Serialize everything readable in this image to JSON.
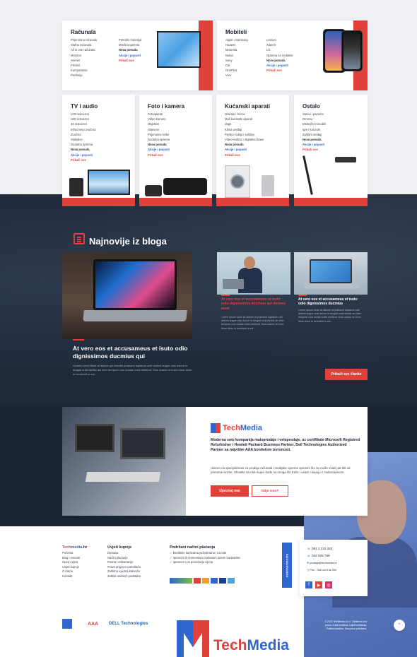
{
  "categories": {
    "racunala": {
      "title": "Računala",
      "col1": [
        "Prijenosna računala",
        "Stolna računala",
        "All in one računala",
        "Monitori",
        "Serveri",
        "Printeri",
        "Komponente",
        "Periferija"
      ],
      "col2": [
        "Potrošni materijal",
        "Mrežna oprema",
        "Nova ponuda",
        "Akcije i popusti",
        "Prikaži sve"
      ]
    },
    "mobiteli": {
      "title": "Mobiteli",
      "col1": [
        "Apple i Samsung",
        "Huawei",
        "Motorola",
        "Nokia",
        "Sony",
        "Cat",
        "OnePlus",
        "Vivo"
      ],
      "col2": [
        "Lenovo",
        "Xiaomi",
        "LG",
        "Oprema za mobitele",
        "Nova ponuda",
        "Akcije i popusti",
        "Prikaži sve"
      ]
    },
    "tv": {
      "title": "TV i audio",
      "items": [
        "LCD televizori",
        "LED televizori",
        "4K televizori",
        "Infracrveni zvučnici",
        "Zvučnici",
        "Slušalice",
        "Dodatna oprema",
        "Nova ponuda",
        "Akcije i popusti",
        "Prikaži sve"
      ]
    },
    "foto": {
      "title": "Foto i kamera",
      "items": [
        "Fotoaparati",
        "Video kamere",
        "Objektivi",
        "Stativovi",
        "Prijenosne torbe",
        "Dodatna oprema",
        "Nova ponuda",
        "Akcije i popusti",
        "Prikaži sve"
      ]
    },
    "kucanski": {
      "title": "Kućanski aparati",
      "items": [
        "Glačala i fenovi",
        "Mali kućanski aparati",
        "Vage",
        "Klima uređaji",
        "Perilice rublja i sušilice",
        "Video-nadzor i digitalne brave",
        "Nova ponuda",
        "Akcije i popusti",
        "Prikaži sve"
      ]
    },
    "ostalo": {
      "title": "Ostalo",
      "items": [
        "Satovi i pametni",
        "Dronovi",
        "Električni romobili",
        "Igre i konzole",
        "Zaštitni uređaji",
        "Nova ponuda",
        "Akcije i popusti",
        "Prikaži sve"
      ]
    }
  },
  "blog": {
    "heading": "Najnovije iz bloga",
    "main_title": "At vero eos et accusameus et isuto odio dignissimos ducmius qui",
    "main_excerpt": "Uvobim kredi Blkdt at diavee qui blanditi praesent luptatum zzril delenit augue duis dolore te feugait nulla facilisi am liber tempore cum soluta nobis eleifend. Duis autem vel eum iriure dolor in hendrerit in vul...",
    "post2_title": "At vero eos et accusameus et isuto odio dignissimos ducmius qui dolores amet",
    "post2_excerpt": "Lorem ipsum dolor sit diavee at praesent luptatum zzril delenit augue duis dolore te feugait nulla facilisi am liber tempore cum soluta nobis eleifend. Duis autem vel eum iriure dolor in hendrerit in vul...",
    "post3_title": "At vero eos et accusameus et isuto odio dignissimos ducmius",
    "post3_excerpt": "Lorem ipsum dolor sit diavee at praesent luptatum zzril delenit augue duis dolore te feugait nulla facilisi am liber tempore cum soluta nobis eleifend. Duis autem vel eum iriure dolor in hendrerit in vul...",
    "all_button": "Prikaži sve članke"
  },
  "about": {
    "brand_part1": "Tech",
    "brand_part2": "Media",
    "bold_text": "Moderna smo kompanija maloprodaje i veleprodaje, uz certifikate Microsoft Registred Refurbisher i Hewlett Packard Business Partner, Dell Technologies Authorized Partner sa najvišim AAA bonitetom izvrsnosti.",
    "text": "Uskoro na specijalizirani za prodaju računala i medijske opreme spremni što ne može svaki put biti od primarne brzine. Shvatite da nam kupci dođu na onoga što traže i usluzi i kupuju s zadovoljstvom.",
    "btn_primary": "Upoznaj nas",
    "btn_secondary": "Gdje smo?"
  },
  "footer": {
    "col1_title_a": "Tech",
    "col1_title_b": "media",
    "col1_title_c": ".hr",
    "col1_items": [
      "Početna",
      "Blog i novosti",
      "Opća uvjeta",
      "Uvjeti kupnje",
      "O nama",
      "Kontakt"
    ],
    "col2_title": "Uvjeti kupnje",
    "col2_items": [
      "Dostava",
      "Načini plaćanja",
      "Povrat i reklamacije",
      "Pravo prigovor potrošača",
      "Zaštitna uvjetna kakvoće",
      "Zaštita osobnih podataka"
    ],
    "col3_title": "Podržani načini plaćanja",
    "col3_items": [
      "kreditnim karticama jednokratno i na rate",
      "opomom ili vremenitom nakratom putem bankarske",
      "opomom i po povećanju cijena"
    ],
    "contact_tab": "KONTAKTIRAJTE",
    "phone1": "091 1 222 333",
    "phone2": "042 625 789",
    "email": "prodaja@techmedia.hr",
    "hours": "Pon - Sub od 8 do 20h",
    "copyright": "© 2022 TechMedia d.o.o. Zaštićena sva prava. Koda izrađena: Uvjeti korištenja. Politika kolačića. Sva prava pridržana.",
    "partners": [
      "AAA",
      "DELL Technologies"
    ]
  },
  "colors": {
    "red": "#e0413b",
    "blue": "#2f66d0",
    "dark": "#1e2a3a"
  }
}
